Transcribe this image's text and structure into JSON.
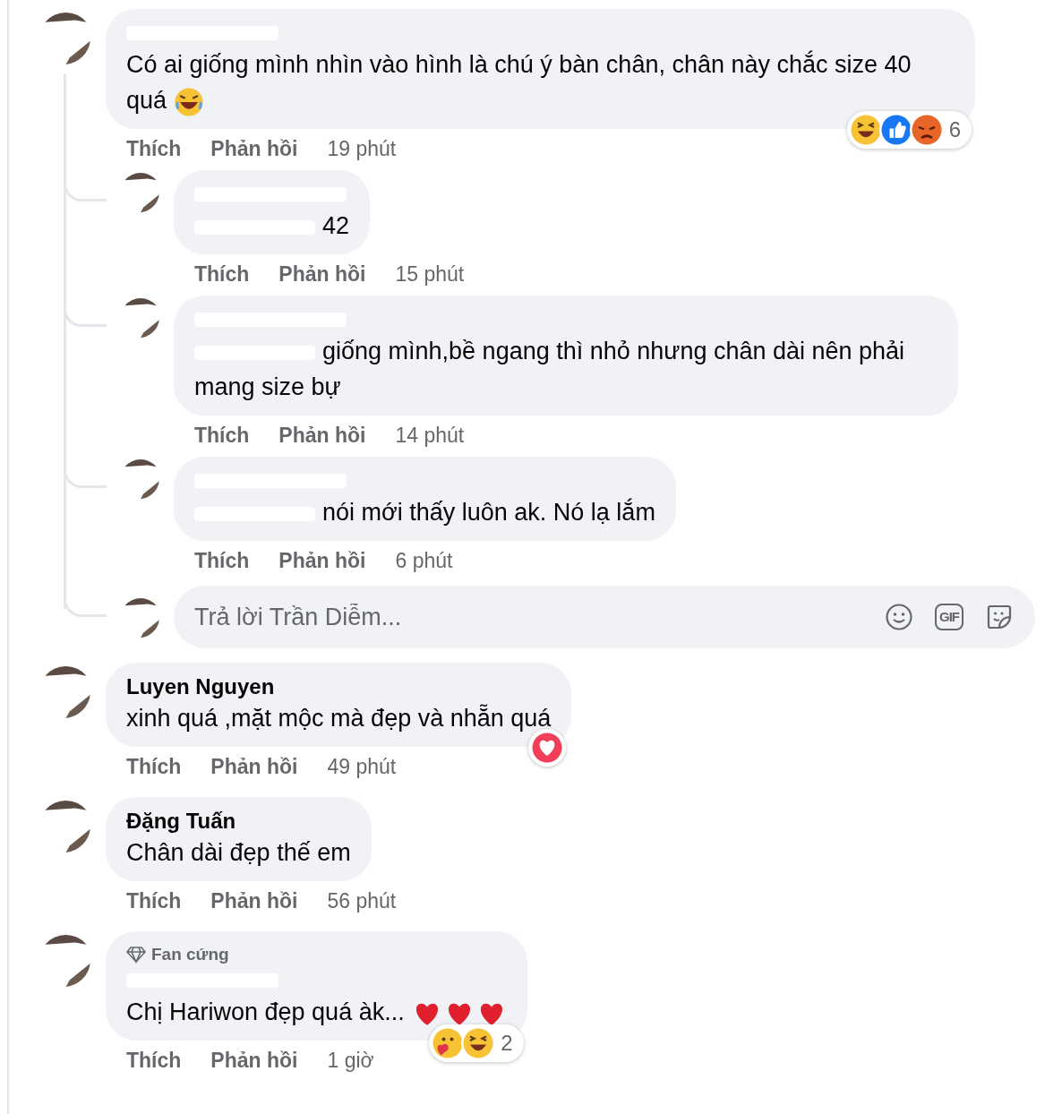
{
  "comments": [
    {
      "name_hidden": true,
      "text": "Có ai giống mình nhìn vào hình là chú ý bàn chân, chân này chắc size 40 quá",
      "emoji": [
        {
          "kind": "laugh"
        }
      ],
      "reactions": {
        "icons": [
          {
            "kind": "haha"
          },
          {
            "kind": "like"
          },
          {
            "kind": "angry"
          }
        ],
        "count": "6"
      },
      "like": "Thích",
      "reply": "Phản hồi",
      "time": "19 phút",
      "replies": [
        {
          "name_hidden": true,
          "mention_hidden": true,
          "text": "42",
          "like": "Thích",
          "reply": "Phản hồi",
          "time": "15 phút"
        },
        {
          "name_hidden": true,
          "mention_hidden": true,
          "text": "giống mình,bề ngang thì nhỏ nhưng chân dài nên phải mang size bự",
          "like": "Thích",
          "reply": "Phản hồi",
          "time": "14 phút"
        },
        {
          "name_hidden": true,
          "mention_hidden": true,
          "text": "nói mới thấy luôn ak. Nó lạ lắm",
          "like": "Thích",
          "reply": "Phản hồi",
          "time": "6 phút"
        }
      ],
      "reply_box": {
        "placeholder": "Trả lời Trần Diễm...",
        "gif_label": "GIF"
      }
    },
    {
      "name": "Luyen Nguyen",
      "text": "xinh quá ,mặt mộc mà đẹp và nhẵn quá",
      "reactions": {
        "icons": [
          {
            "kind": "love"
          }
        ]
      },
      "like": "Thích",
      "reply": "Phản hồi",
      "time": "49 phút"
    },
    {
      "name": "Đặng Tuấn",
      "text": "Chân dài đẹp thế em",
      "like": "Thích",
      "reply": "Phản hồi",
      "time": "56 phút"
    },
    {
      "badge": "Fan cứng",
      "name_hidden": true,
      "text": "Chị Hariwon đẹp quá àk...",
      "emoji": [
        {
          "kind": "heart"
        },
        {
          "kind": "heart"
        },
        {
          "kind": "heart"
        }
      ],
      "reactions": {
        "icons": [
          {
            "kind": "care"
          },
          {
            "kind": "haha"
          }
        ],
        "count": "2"
      },
      "like": "Thích",
      "reply": "Phản hồi",
      "time": "1 giờ"
    }
  ]
}
